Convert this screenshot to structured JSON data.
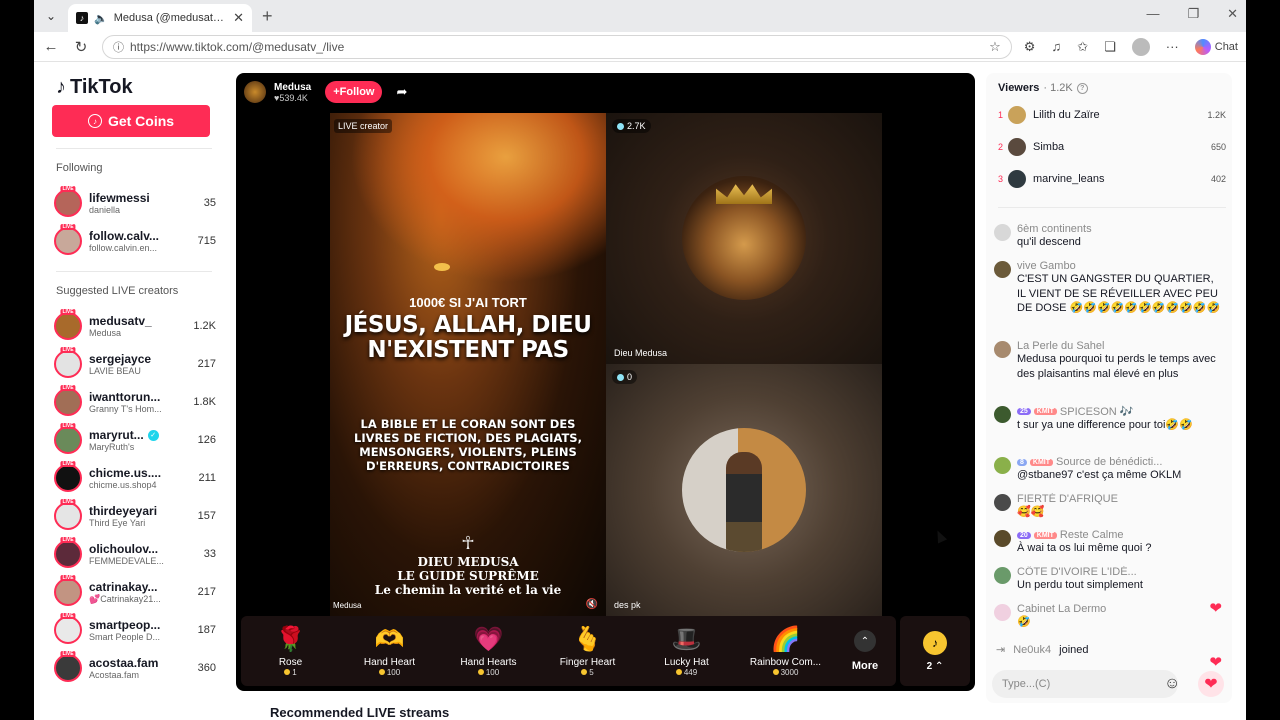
{
  "browser": {
    "tab_title": "Medusa (@medusatv_) is LIVE",
    "url_text": "https://www.tiktok.com/@medusatv_/live",
    "chat_label": "Chat"
  },
  "sidebar": {
    "logo": "TikTok",
    "get_coins": "Get Coins",
    "following_title": "Following",
    "following": [
      {
        "name": "lifewmessi",
        "sub": "daniella",
        "count": "35",
        "color": "#b5655a"
      },
      {
        "name": "follow.calv...",
        "sub": "follow.calvin.en...",
        "count": "715",
        "color": "#c8a89a"
      }
    ],
    "suggested_title": "Suggested LIVE creators",
    "suggested": [
      {
        "name": "medusatv_",
        "sub": "Medusa",
        "count": "1.2K",
        "color": "#a86a2b",
        "verified": false
      },
      {
        "name": "sergejayce",
        "sub": "LAVIE BEAU",
        "count": "217",
        "color": "#e3e3e3",
        "verified": false
      },
      {
        "name": "iwanttorun...",
        "sub": "Granny T's Hom...",
        "count": "1.8K",
        "color": "#a16e56",
        "verified": false
      },
      {
        "name": "maryrut...",
        "sub": "MaryRuth's",
        "count": "126",
        "color": "#6a8a5a",
        "verified": true
      },
      {
        "name": "chicme.us....",
        "sub": "chicme.us.shop4",
        "count": "211",
        "color": "#111111",
        "verified": false
      },
      {
        "name": "thirdeyeyari",
        "sub": "Third Eye Yari",
        "count": "157",
        "color": "#e5e5e5",
        "verified": false
      },
      {
        "name": "olichoulov...",
        "sub": "FEMMEDEVALE...",
        "count": "33",
        "color": "#5c2a3a",
        "verified": false
      },
      {
        "name": "catrinakay...",
        "sub": "💕Catrinakay21...",
        "count": "217",
        "color": "#c29482",
        "verified": false
      },
      {
        "name": "smartpeop...",
        "sub": "Smart People D...",
        "count": "187",
        "color": "#e9e9e9",
        "verified": false
      },
      {
        "name": "acostaa.fam",
        "sub": "Acostaa.fam",
        "count": "360",
        "color": "#3a3a3a",
        "verified": false
      }
    ]
  },
  "player": {
    "host_name": "Medusa",
    "host_likes": "♥539.4K",
    "follow_label": "+Follow",
    "live_creator_tag": "LIVE creator",
    "poster_line1": "1000€ SI J'AI TORT",
    "poster_line2": "JÉSUS, ALLAH, DIEU N'EXISTENT PAS",
    "poster_line3": "LA BIBLE ET LE CORAN SONT DES LIVRES DE FICTION, DES PLAGIATS, MENSONGERS, VIOLENTS, PLEINS D'ERREURS, CONTRADICTOIRES",
    "poster_line4": "☥",
    "poster_line5a": "DIEU MEDUSA",
    "poster_line5b": "LE GUIDE SUPRÊME",
    "poster_line5c": "Le chemin la verité et la vie",
    "host_label": "Medusa",
    "guest1_viewers": "2.7K",
    "guest1_label": "Dieu Medusa",
    "guest2_viewers": "0",
    "guest2_label": "des pk"
  },
  "gifts": [
    {
      "name": "Rose",
      "price": "1",
      "icon": "🌹"
    },
    {
      "name": "Hand Heart",
      "price": "100",
      "icon": "🫶"
    },
    {
      "name": "Hand Hearts",
      "price": "100",
      "icon": "💗"
    },
    {
      "name": "Finger Heart",
      "price": "5",
      "icon": "🫰"
    },
    {
      "name": "Lucky Hat",
      "price": "449",
      "icon": "🎩"
    },
    {
      "name": "Rainbow Com...",
      "price": "3000",
      "icon": "🌈"
    }
  ],
  "more_label": "More",
  "coin_count": "2",
  "recommended_title": "Recommended LIVE streams",
  "chat": {
    "viewers_title": "Viewers",
    "viewers_count": "· 1.2K",
    "top_viewers": [
      {
        "rank": "1",
        "name": "Lilith du Zaïre",
        "score": "1.2K",
        "color": "#c9a25a"
      },
      {
        "rank": "2",
        "name": "Simba",
        "score": "650",
        "color": "#5a4a3e"
      },
      {
        "rank": "3",
        "name": "marvine_leans",
        "score": "402",
        "color": "#2f3a40"
      }
    ],
    "messages": [
      {
        "user": "6èm continents",
        "text": "qu'il descend",
        "color": "#d8d8d8",
        "lvl": "",
        "kmit": ""
      },
      {
        "user": "vive Gambo",
        "text": "C'EST UN GANGSTER DU QUARTIER, IL VIENT DE SE RÉVEILLER AVEC PEU DE DOSE 🤣🤣🤣🤣🤣🤣🤣🤣🤣🤣🤣",
        "color": "#6b5a3a",
        "lvl": "",
        "kmit": ""
      },
      {
        "user": "La Perle du Sahel",
        "text": "Medusa pourquoi tu perds le temps avec des plaisantins mal élevé en plus",
        "color": "#a78a6e",
        "lvl": "",
        "kmit": ""
      },
      {
        "user": "SPICESON 🎶",
        "text": "t sur ya une difference pour toi🤣🤣",
        "color": "#3c5a2e",
        "lvl": "25",
        "kmit": "KMIT"
      },
      {
        "user": "Source de bénédicti...",
        "text": "@stbane97 c'est ça même OKLM",
        "color": "#8ab04a",
        "lvl": "8",
        "kmit": "KMIT"
      },
      {
        "user": "FIERTÉ D'AFRIQUE",
        "text": "🥰🥰",
        "color": "#4a4a4a",
        "lvl": "",
        "kmit": ""
      },
      {
        "user": "Reste Calme",
        "text": "À wai ta os lui même quoi ?",
        "color": "#5a4a2a",
        "lvl": "20",
        "kmit": "KMIT"
      },
      {
        "user": "CÔTE D'IVOIRE L'IDÉ...",
        "text": "Un perdu tout simplement",
        "color": "#6a9a6a",
        "lvl": "",
        "kmit": ""
      },
      {
        "user": "Cabinet La Dermo",
        "text": "🤣",
        "color": "#f0d0e0",
        "lvl": "",
        "kmit": ""
      }
    ],
    "joined_user": "Ne0uk4",
    "joined_text": "joined",
    "input_placeholder": "Type...(C)"
  }
}
